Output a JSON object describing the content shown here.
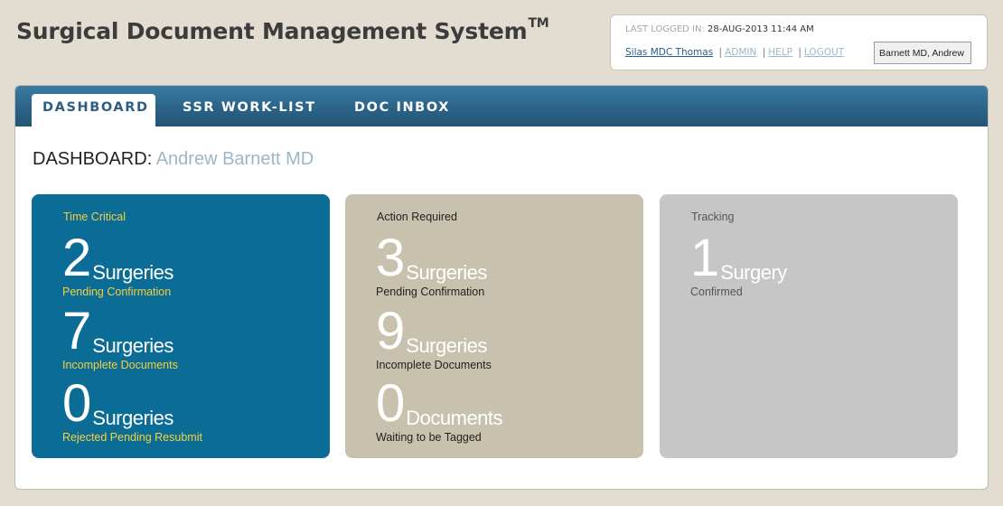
{
  "header": {
    "title": "Surgical Document Management System",
    "trademark": "TM"
  },
  "session": {
    "last_logged_label": "LAST LOGGED IN:",
    "last_logged_value": "28-AUG-2013 11:44 AM",
    "user_link": "Silas MDC Thomas",
    "admin_link": "ADMIN",
    "help_link": "HELP",
    "logout_link": "LOGOUT",
    "separator": "|",
    "selected_provider": "Barnett MD, Andrew"
  },
  "tabs": [
    {
      "label": "DASHBOARD",
      "active": true
    },
    {
      "label": "SSR WORK-LIST",
      "active": false
    },
    {
      "label": "DOC INBOX",
      "active": false
    }
  ],
  "dashboard": {
    "heading_prefix": "DASHBOARD:",
    "heading_name": "Andrew Barnett MD"
  },
  "cards": [
    {
      "title": "Time Critical",
      "color": "#0b6d96",
      "stats": [
        {
          "value": "2",
          "unit": "Surgeries",
          "label": "Pending Confirmation"
        },
        {
          "value": "7",
          "unit": "Surgeries",
          "label": "Incomplete Documents"
        },
        {
          "value": "0",
          "unit": "Surgeries",
          "label": "Rejected Pending Resubmit"
        }
      ]
    },
    {
      "title": "Action Required",
      "color": "#c7c1ad",
      "stats": [
        {
          "value": "3",
          "unit": "Surgeries",
          "label": "Pending Confirmation"
        },
        {
          "value": "9",
          "unit": "Surgeries",
          "label": "Incomplete Documents"
        },
        {
          "value": "0",
          "unit": "Documents",
          "label": "Waiting to be Tagged"
        }
      ]
    },
    {
      "title": "Tracking",
      "color": "#c6c6c6",
      "stats": [
        {
          "value": "1",
          "unit": "Surgery",
          "label": "Confirmed"
        }
      ]
    }
  ]
}
